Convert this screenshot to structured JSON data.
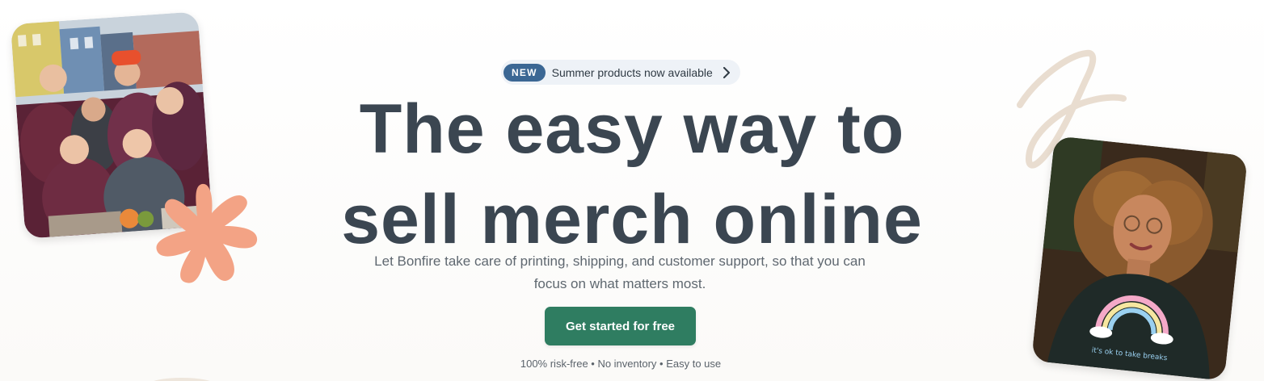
{
  "announcement": {
    "badge": "NEW",
    "text": "Summer products now available",
    "icon": "chevron-right-icon"
  },
  "hero": {
    "headline_line1": "The easy way to",
    "headline_line2": "sell merch online",
    "subtext": "Let Bonfire take care of printing, shipping, and customer support, so that you can focus on what matters most.",
    "cta_label": "Get started for free",
    "tagline": "100% risk-free • No inventory • Easy to use"
  },
  "images": {
    "left_photo": "group-photo-farm-volunteers",
    "right_photo": "portrait-woman-rainbow-sweatshirt",
    "right_shirt_text": "it's ok to take breaks"
  },
  "colors": {
    "headline": "#3b4651",
    "badge_bg": "#3b6794",
    "cta_bg": "#2f7d61",
    "accent_burst": "#f3a385",
    "swirl": "#e9ddd0"
  }
}
